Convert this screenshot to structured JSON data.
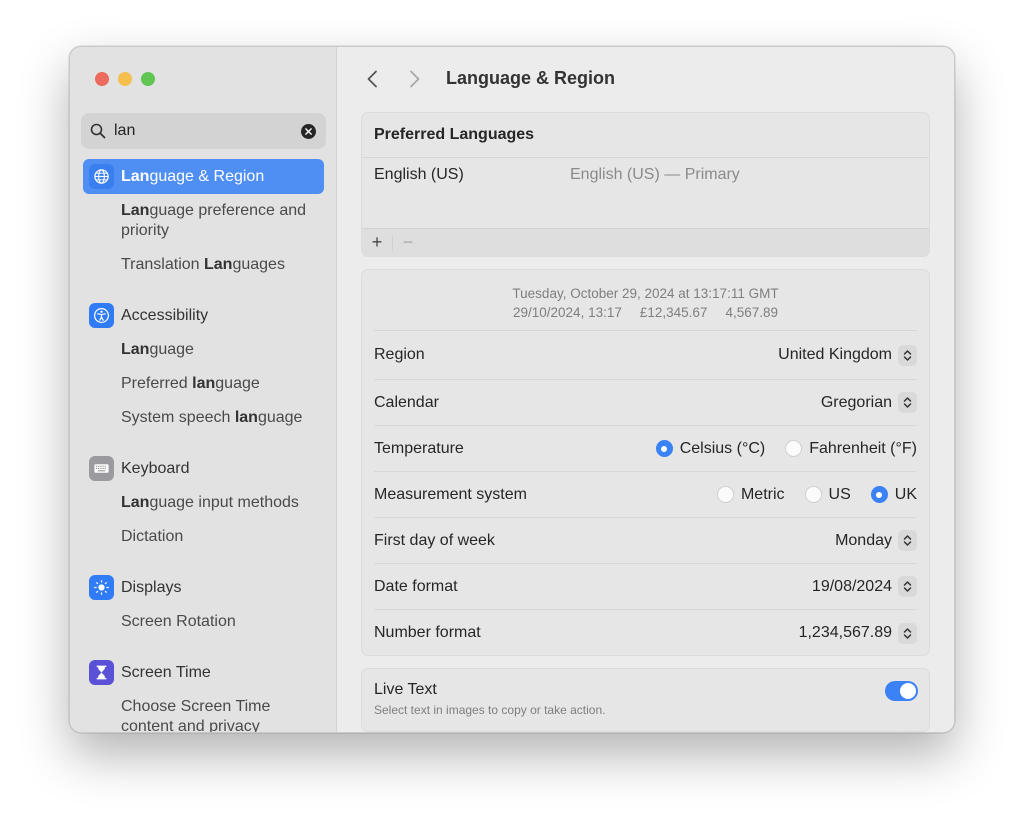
{
  "window": {
    "title": "Language & Region",
    "traffic_lights": [
      "close",
      "minimize",
      "maximize"
    ]
  },
  "search": {
    "value": "lan",
    "icon": "magnifying-glass-icon",
    "clear_icon": "clear-icon"
  },
  "sidebar": {
    "groups": [
      {
        "label_bold": "Lan",
        "label_rest": "guage & Region",
        "icon": "globe-icon",
        "selected": true,
        "subitems": [
          {
            "bold": "Lan",
            "rest": "guage preference and priority"
          },
          {
            "pre": "Translation ",
            "bold": "Lan",
            "rest": "guages"
          }
        ]
      },
      {
        "label": "Accessibility",
        "icon": "accessibility-icon",
        "subitems": [
          {
            "bold": "Lan",
            "rest": "guage"
          },
          {
            "pre": "Preferred ",
            "bold": "lan",
            "rest": "guage"
          },
          {
            "pre": "System speech ",
            "bold": "lan",
            "rest": "guage"
          }
        ]
      },
      {
        "label": "Keyboard",
        "icon": "keyboard-icon",
        "subitems": [
          {
            "bold": "Lan",
            "rest": "guage input methods"
          },
          {
            "rest": "Dictation"
          }
        ]
      },
      {
        "label": "Displays",
        "icon": "sun-icon",
        "subitems": [
          {
            "rest": "Screen Rotation"
          }
        ]
      },
      {
        "label": "Screen Time",
        "icon": "hourglass-icon",
        "subitems": [
          {
            "rest": "Choose Screen Time content and privacy"
          }
        ]
      }
    ]
  },
  "toolbar": {
    "back": "back-chevron-icon",
    "forward": "forward-chevron-icon",
    "title": "Language & Region"
  },
  "preferred_languages": {
    "header": "Preferred Languages",
    "languages": [
      {
        "name": "English (US)",
        "description": "English (US) — Primary"
      }
    ],
    "add_label": "+",
    "remove_label": "−"
  },
  "region_settings": {
    "preview_line1": "Tuesday, October 29, 2024 at 13:17:11 GMT",
    "preview_date": "29/10/2024, 13:17",
    "preview_currency": "£12,345.67",
    "preview_number": "4,567.89",
    "rows": {
      "region": {
        "label": "Region",
        "value": "United Kingdom"
      },
      "calendar": {
        "label": "Calendar",
        "value": "Gregorian"
      },
      "temperature": {
        "label": "Temperature",
        "options": [
          "Celsius (°C)",
          "Fahrenheit (°F)"
        ],
        "selected": "Celsius (°C)"
      },
      "measurement": {
        "label": "Measurement system",
        "options": [
          "Metric",
          "US",
          "UK"
        ],
        "selected": "UK"
      },
      "first_day": {
        "label": "First day of week",
        "value": "Monday"
      },
      "date_format": {
        "label": "Date format",
        "value": "19/08/2024"
      },
      "number_format": {
        "label": "Number format",
        "value": "1,234,567.89"
      }
    }
  },
  "live_text": {
    "title": "Live Text",
    "subtitle": "Select text in images to copy or take action.",
    "enabled": true
  },
  "colors": {
    "accent": "#3b82f6",
    "selection": "#4f8ef3",
    "close": "#ec6a5e",
    "minimize": "#f4bf4f",
    "maximize": "#61c554"
  }
}
